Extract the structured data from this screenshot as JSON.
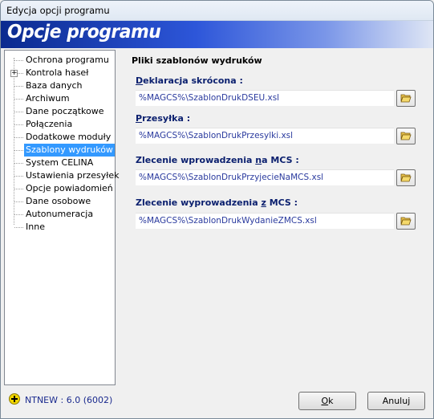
{
  "window": {
    "title": "Edycja opcji programu"
  },
  "banner": {
    "title": "Opcje programu"
  },
  "tree": {
    "items": [
      {
        "label": "Ochrona programu",
        "expandable": false
      },
      {
        "label": "Kontrola haseł",
        "expandable": true
      },
      {
        "label": "Baza danych",
        "expandable": false
      },
      {
        "label": "Archiwum",
        "expandable": false
      },
      {
        "label": "Dane początkowe",
        "expandable": false
      },
      {
        "label": "Połączenia",
        "expandable": false
      },
      {
        "label": "Dodatkowe moduły",
        "expandable": false
      },
      {
        "label": "Szablony wydruków",
        "selected": true
      },
      {
        "label": "System CELINA",
        "expandable": false
      },
      {
        "label": "Ustawienia przesyłek",
        "expandable": false
      },
      {
        "label": "Opcje powiadomień",
        "expandable": false
      },
      {
        "label": "Dane osobowe",
        "expandable": false
      },
      {
        "label": "Autonumeracja",
        "expandable": false
      },
      {
        "label": "Inne",
        "expandable": false
      }
    ],
    "expander_symbol": "+"
  },
  "content": {
    "heading": "Pliki szablonów wydruków",
    "fields": [
      {
        "label_pre": "",
        "label_u": "D",
        "label_post": "eklaracja skrócona :",
        "value": "%MAGCS%\\SzablonDrukDSEU.xsl"
      },
      {
        "label_pre": "",
        "label_u": "P",
        "label_post": "rzesyłka :",
        "value": "%MAGCS%\\SzablonDrukPrzesylki.xsl"
      },
      {
        "label_pre": "Zlecenie wprowadzenia ",
        "label_u": "n",
        "label_post": "a MCS :",
        "value": "%MAGCS%\\SzablonDrukPrzyjecieNaMCS.xsl"
      },
      {
        "label_pre": "Zlecenie wyprowadzenia ",
        "label_u": "z",
        "label_post": " MCS :",
        "value": "%MAGCS%\\SzablonDrukWydanieZMCS.xsl"
      }
    ],
    "browse_icon": "folder-open-icon"
  },
  "footer": {
    "version": "NTNEW : 6.0 (6002)",
    "ok_u": "O",
    "ok_rest": "k",
    "cancel": "Anuluj"
  },
  "colors": {
    "selection": "#3399ff",
    "banner_start": "#0b2a8f",
    "label_text": "#0a1f6e"
  }
}
